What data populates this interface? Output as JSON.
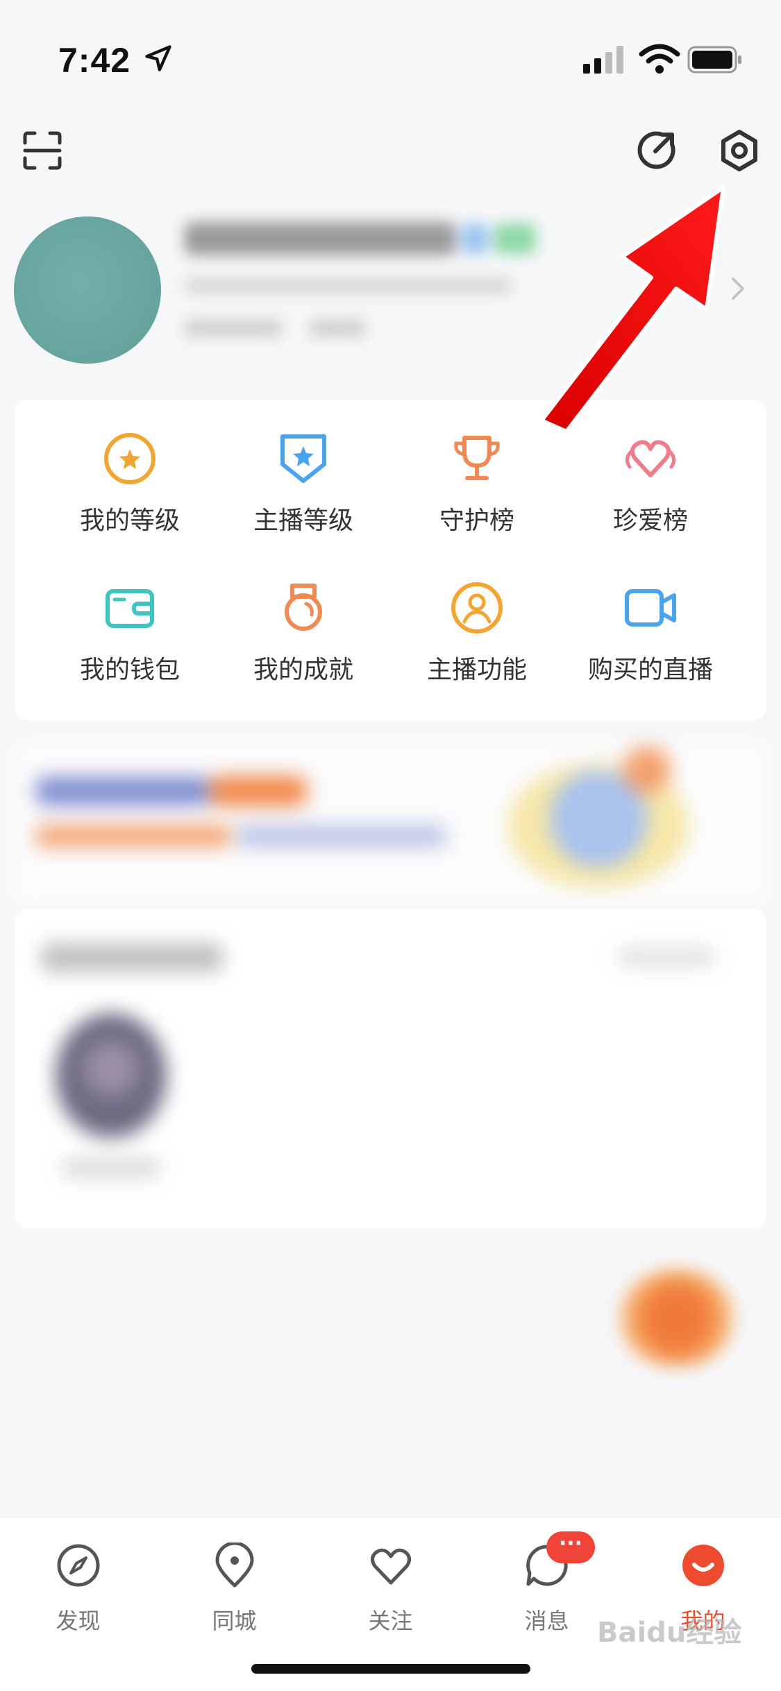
{
  "status_bar": {
    "time": "7:42",
    "icons": [
      "location-arrow-icon",
      "signal-icon",
      "wifi-icon",
      "battery-icon"
    ]
  },
  "toolbar": {
    "icons": [
      "scan-icon",
      "edit-icon",
      "settings-icon"
    ]
  },
  "profile": {
    "avatar_color": "#6aa8a2"
  },
  "grid": {
    "items": [
      {
        "label": "我的等级",
        "icon": "level-star-icon",
        "color": "#f3a531"
      },
      {
        "label": "主播等级",
        "icon": "anchor-level-shield-icon",
        "color": "#4aa3ef"
      },
      {
        "label": "守护榜",
        "icon": "trophy-icon",
        "color": "#f08a52"
      },
      {
        "label": "珍爱榜",
        "icon": "heart-wings-icon",
        "color": "#f07b8a"
      },
      {
        "label": "我的钱包",
        "icon": "wallet-icon",
        "color": "#3fc4c0"
      },
      {
        "label": "我的成就",
        "icon": "medal-icon",
        "color": "#f08a52"
      },
      {
        "label": "主播功能",
        "icon": "anchor-user-icon",
        "color": "#f3a531"
      },
      {
        "label": "购买的直播",
        "icon": "video-camera-icon",
        "color": "#4aa3ef"
      }
    ]
  },
  "tabbar": {
    "tabs": [
      {
        "label": "发现",
        "icon": "compass-icon"
      },
      {
        "label": "同城",
        "icon": "location-pin-icon"
      },
      {
        "label": "关注",
        "icon": "heart-icon"
      },
      {
        "label": "消息",
        "icon": "message-bubble-icon",
        "badge": "···"
      },
      {
        "label": "我的",
        "icon": "me-face-icon",
        "active": true
      }
    ],
    "active_color": "#ef4b30"
  },
  "watermark": "Baidu经验"
}
